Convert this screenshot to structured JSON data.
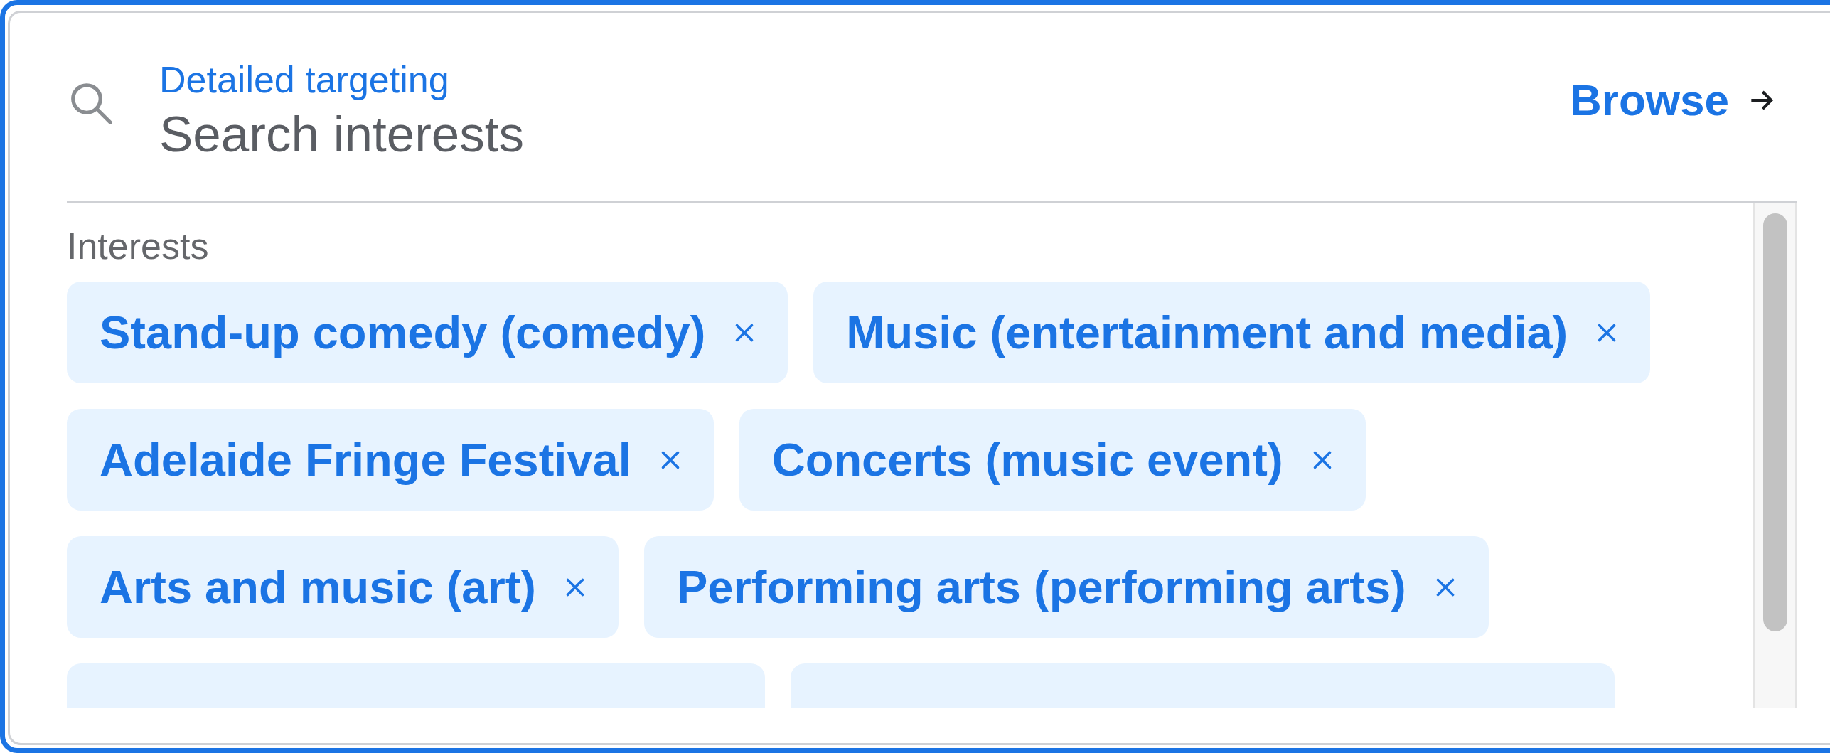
{
  "search": {
    "label": "Detailed targeting",
    "placeholder": "Search interests"
  },
  "browse": {
    "label": "Browse"
  },
  "section": {
    "title": "Interests"
  },
  "chips": [
    {
      "kind": "chip",
      "label": "Stand-up comedy (comedy)"
    },
    {
      "kind": "chip",
      "label": "Music (entertainment and media)"
    },
    {
      "kind": "chip",
      "label": "Adelaide Fringe Festival"
    },
    {
      "kind": "chip",
      "label": "Concerts (music event)"
    },
    {
      "kind": "chip",
      "label": "Arts and music (art)"
    },
    {
      "kind": "chip",
      "label": "Performing arts (performing arts)"
    },
    {
      "kind": "cut"
    },
    {
      "kind": "cut"
    }
  ]
}
